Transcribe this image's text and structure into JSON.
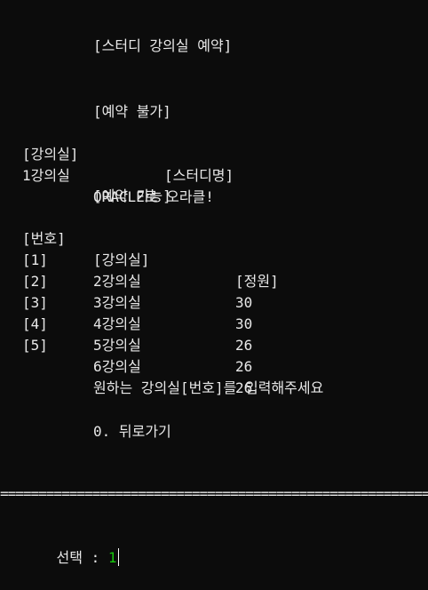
{
  "title": "[스터디 강의실 예약]",
  "unavailable": {
    "heading": "[예약 불가]",
    "col_room": "[강의실]",
    "col_study": "[스터디명]",
    "rows": [
      {
        "room": "1강의실",
        "study": "ORACLE로 오라클!"
      }
    ]
  },
  "available": {
    "heading": "[예약 가능]",
    "col_no": "[번호]",
    "col_room": "[강의실]",
    "col_capacity": "[정원]",
    "rows": [
      {
        "no": "[1]",
        "room": "2강의실",
        "capacity": "30"
      },
      {
        "no": "[2]",
        "room": "3강의실",
        "capacity": "30"
      },
      {
        "no": "[3]",
        "room": "4강의실",
        "capacity": "26"
      },
      {
        "no": "[4]",
        "room": "5강의실",
        "capacity": "26"
      },
      {
        "no": "[5]",
        "room": "6강의실",
        "capacity": "26"
      }
    ]
  },
  "prompt": "원하는 강의실[번호]를 입력해주세요",
  "back_option": "0. 뒤로가기",
  "separator": "====================================================================================",
  "input": {
    "label": "선택 : ",
    "value": "1"
  },
  "colors": {
    "background": "#0c0c0c",
    "text": "#e8e8e8",
    "input": "#16c60c"
  }
}
